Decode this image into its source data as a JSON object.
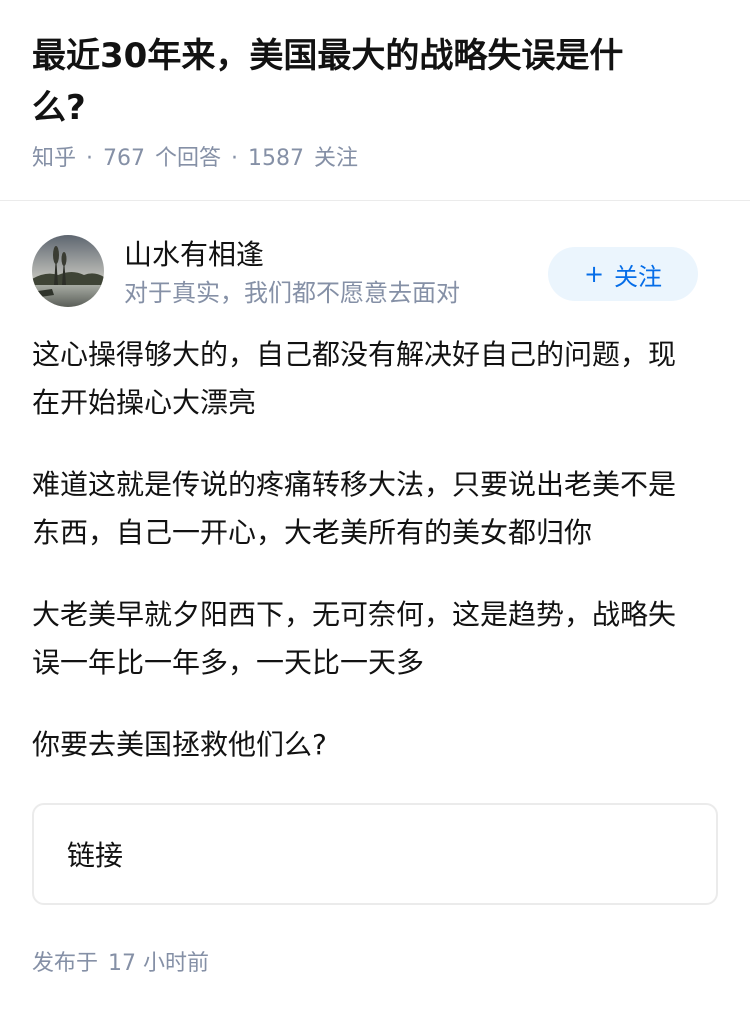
{
  "question": {
    "title": "最近30年来，美国最大的战略失误是什么?",
    "source": "知乎",
    "answers_count": "767",
    "answers_label": "个回答",
    "followers_count": "1587",
    "followers_label": "关注"
  },
  "author": {
    "avatar_icon": "landscape-avatar",
    "name": "山水有相逢",
    "bio": "对于真实，我们都不愿意去面对",
    "follow_label": "关注",
    "follow_icon": "plus-icon"
  },
  "answer": {
    "paragraphs": [
      "这心操得够大的，自己都没有解决好自己的问题，现在开始操心大漂亮",
      "难道这就是传说的疼痛转移大法，只要说出老美不是东西，自己一开心，大老美所有的美女都归你",
      "大老美早就夕阳西下，无可奈何，这是趋势，战略失误一年比一年多，一天比一天多",
      "你要去美国拯救他们么?"
    ],
    "link_label": "链接"
  },
  "publish": {
    "label": "发布于",
    "time": "17 小时前"
  },
  "colors": {
    "text": "#121212",
    "meta": "#8590a6",
    "accent": "#056de8",
    "follow_bg": "#ebf5fd"
  }
}
